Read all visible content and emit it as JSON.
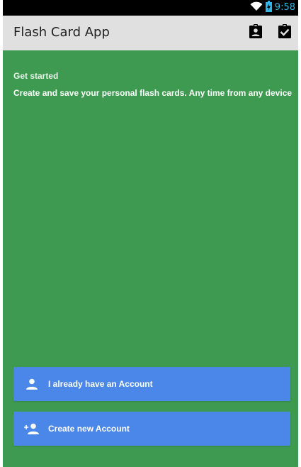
{
  "status_bar": {
    "time": "9:58",
    "icons": [
      "wifi-icon",
      "battery-charging-icon"
    ],
    "time_color": "#33b5e5"
  },
  "app_bar": {
    "title": "Flash Card App",
    "actions": [
      "account-clipboard-icon",
      "check-clipboard-icon"
    ]
  },
  "content": {
    "background": "#3e9a51",
    "intro_title": "Get started",
    "intro_text": "Create and save your personal flash cards. Any time from any device"
  },
  "buttons": {
    "color": "#4a87e8",
    "login": {
      "label": "I already have an Account",
      "icon": "person-icon"
    },
    "create": {
      "label": "Create new Account",
      "icon": "person-add-icon"
    }
  }
}
